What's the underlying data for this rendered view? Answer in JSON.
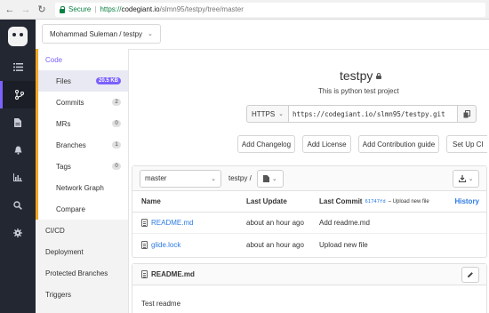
{
  "browser": {
    "secure_label": "Secure",
    "separator": "|",
    "url_scheme": "https://",
    "url_host": "codegiant.io",
    "url_path": "/slmn95/testpy/tree/master"
  },
  "rail": {
    "icons": [
      "list-icon",
      "git-branch-icon",
      "document-icon",
      "bell-icon",
      "bar-chart-icon",
      "search-icon",
      "settings-icon"
    ],
    "active_index": 1
  },
  "project_selector": {
    "label": "Mohammad Suleman / testpy"
  },
  "sidebar": {
    "code": "Code",
    "files": {
      "label": "Files",
      "count": "20.5 KB"
    },
    "commits": {
      "label": "Commits",
      "count": "2"
    },
    "mrs": {
      "label": "MRs",
      "count": "0"
    },
    "branches": {
      "label": "Branches",
      "count": "1"
    },
    "tags": {
      "label": "Tags",
      "count": "0"
    },
    "network_graph": "Network Graph",
    "compare": "Compare",
    "cicd": "CI/CD",
    "deployment": "Deployment",
    "protected_branches": "Protected Branches",
    "triggers": "Triggers"
  },
  "repo": {
    "name": "testpy",
    "description": "This is python test project",
    "clone": {
      "protocol": "HTTPS",
      "url": "https://codegiant.io/slmn95/testpy.git"
    },
    "actions": {
      "add_changelog": "Add Changelog",
      "add_license": "Add License",
      "add_contribution": "Add Contribution guide",
      "setup_ci": "Set Up CI"
    }
  },
  "browser_panel": {
    "branch": "master",
    "path": "testpy",
    "path_sep": "/",
    "columns": {
      "name": "Name",
      "last_update": "Last Update",
      "last_commit": "Last Commit",
      "last_commit_sha": "61747fd",
      "last_commit_msg": "Upload new file",
      "history": "History"
    },
    "rows": [
      {
        "name": "README.md",
        "updated": "about an hour ago",
        "commit": "Add readme.md"
      },
      {
        "name": "glide.lock",
        "updated": "about an hour ago",
        "commit": "Upload new file"
      }
    ]
  },
  "readme": {
    "title": "README.md",
    "body": "Test readme"
  },
  "colors": {
    "accent": "#7b61ff",
    "active_marker": "#f5a623",
    "rail_bg": "#232732",
    "link": "#2c7be5",
    "secure": "#0b8043"
  }
}
